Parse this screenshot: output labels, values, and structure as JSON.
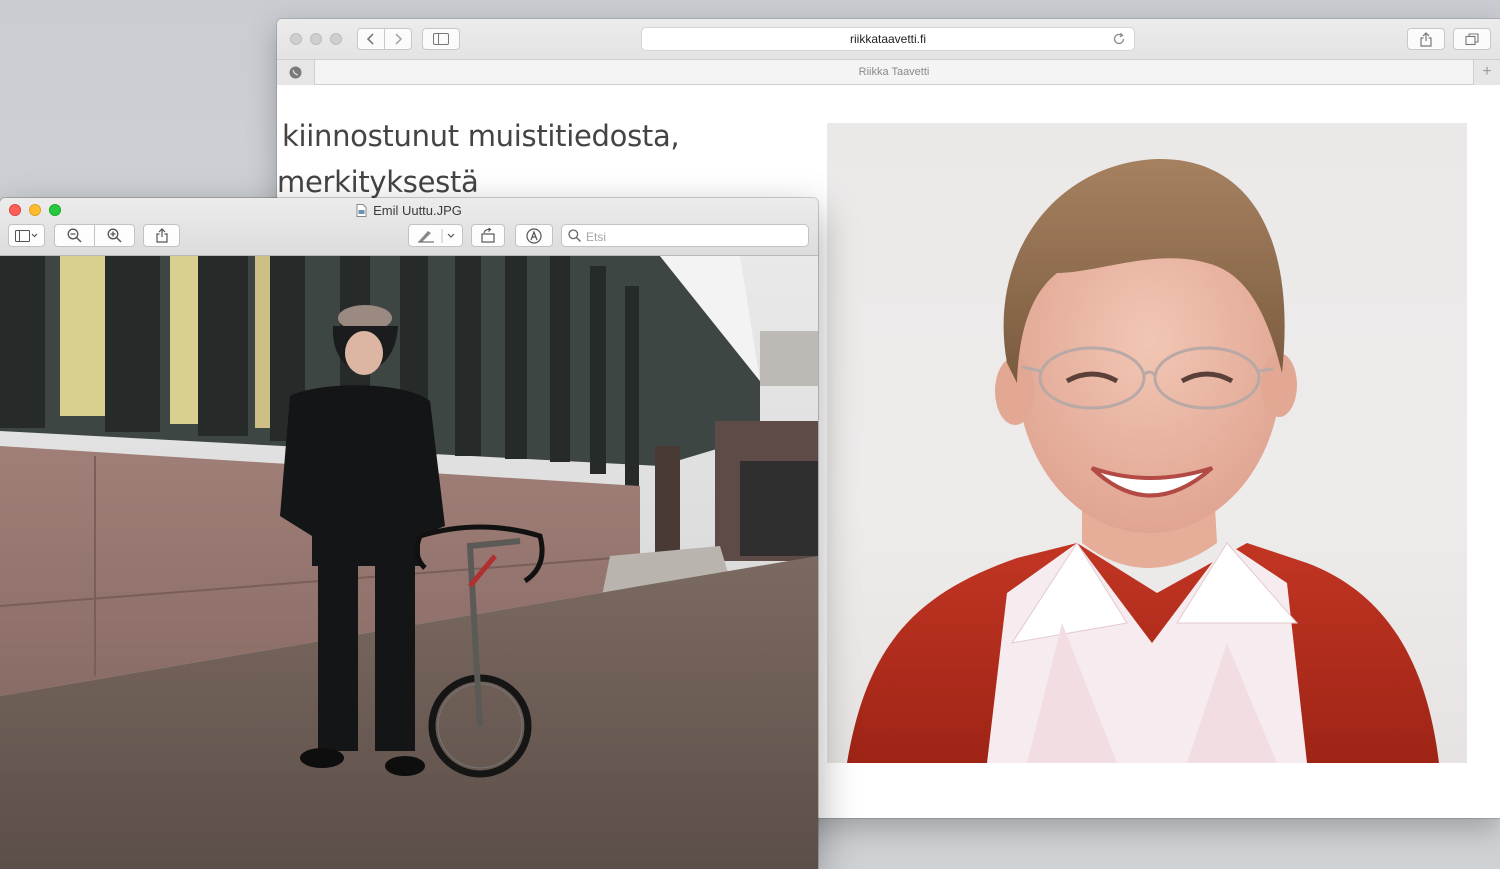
{
  "browser": {
    "url": "riikkataavetti.fi",
    "tab_title": "Riikka Taavetti",
    "new_tab_symbol": "+"
  },
  "page": {
    "text_line_1": "kiinnostunut muistitiedosta,",
    "text_line_2": "merkityksestä"
  },
  "preview": {
    "filename": "Emil Uuttu.JPG",
    "search_placeholder": "Etsi"
  },
  "icons": {
    "sidebar": "sidebar-icon",
    "zoom_out": "zoom-out-icon",
    "zoom_in": "zoom-in-icon",
    "share": "share-icon",
    "markup": "pen-icon",
    "rotate": "rotate-icon",
    "annotate": "markup-icon",
    "search": "search-icon"
  },
  "colors": {
    "close": "#ff5f57",
    "minimize": "#febc2e",
    "zoom": "#28c840"
  }
}
